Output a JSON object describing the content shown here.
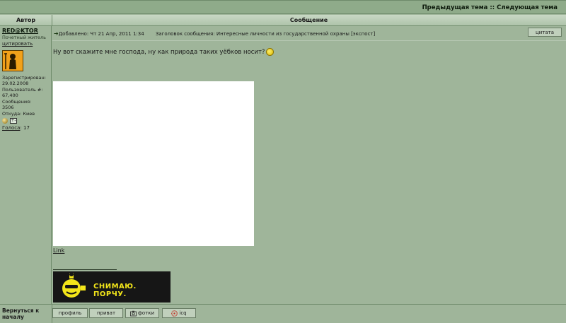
{
  "topnav": {
    "prev_topic": "Предыдущая тема",
    "separator": "::",
    "next_topic": "Следующая тема"
  },
  "table_header": {
    "author": "Автор",
    "message": "Сообщение"
  },
  "author": {
    "name": "RED@KTOR",
    "rank": "Почетный житель",
    "quote_link": "цитировать",
    "registered_label": "Зарегистрирован:",
    "registered_value": "29.02.2008",
    "user_number_label": "Пользователь #:",
    "user_number_value": "67,400",
    "posts_label": "Сообщения:",
    "posts_value": "3506",
    "location_label": "Откуда:",
    "location_value": "Киев",
    "votes_label": "Голоса",
    "votes_value": "17"
  },
  "post": {
    "added_label": "Добавлено:",
    "date": "Чт 21 Апр, 2011 1:34",
    "subject_label": "Заголовок сообщения:",
    "subject": "Интересные личности из государственной охраны [экспост]",
    "quote_button": "цитата",
    "text": "Ну вот скажите мне господа, ну как природа таких уёбков носит?",
    "link_text": "Link",
    "signature_text": "СНИМАЮ. ПОРЧУ."
  },
  "footer": {
    "back_to_top": "Вернуться к началу",
    "buttons": {
      "profile": "профиль",
      "private": "приват",
      "photos": "фотки",
      "icq": "icq"
    }
  },
  "colors": {
    "background": "#9fb59a",
    "topbar": "#8fab8a",
    "border": "#6e8a6a",
    "signature_text": "#f3e61a"
  }
}
